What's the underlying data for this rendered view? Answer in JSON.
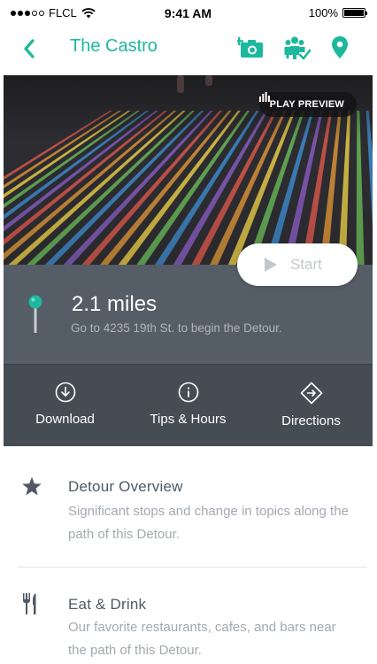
{
  "status_bar": {
    "carrier": "FLCL",
    "time": "9:41 AM",
    "battery": "100%",
    "battery_level": 1.0
  },
  "nav": {
    "title": "The Castro",
    "icons": [
      "chevron-left-icon",
      "camera-add-icon",
      "group-check-icon",
      "location-pin-icon"
    ]
  },
  "hero": {
    "preview_label": "PLAY PREVIEW",
    "start_label": "Start",
    "stripe_colors": [
      "#e35a4f",
      "#e59a3a",
      "#f2d54a",
      "#6dbf5c",
      "#3f8fd6",
      "#8c5fc9"
    ]
  },
  "info": {
    "distance": "2.1 miles",
    "instruction": "Go to 4235 19th St. to begin the Detour."
  },
  "actions": [
    {
      "label": "Download",
      "icon": "download-icon"
    },
    {
      "label": "Tips & Hours",
      "icon": "info-icon"
    },
    {
      "label": "Directions",
      "icon": "directions-icon"
    }
  ],
  "list": [
    {
      "title": "Detour Overview",
      "description": "Significant stops and change in topics along the path of this Detour.",
      "icon": "star-icon"
    },
    {
      "title": "Eat & Drink",
      "description": "Our favorite restaurants, cafes, and bars near the path of this Detour.",
      "icon": "fork-knife-icon"
    }
  ],
  "colors": {
    "accent": "#1db89d",
    "panel": "#555d66",
    "action_bar": "#464c54"
  }
}
